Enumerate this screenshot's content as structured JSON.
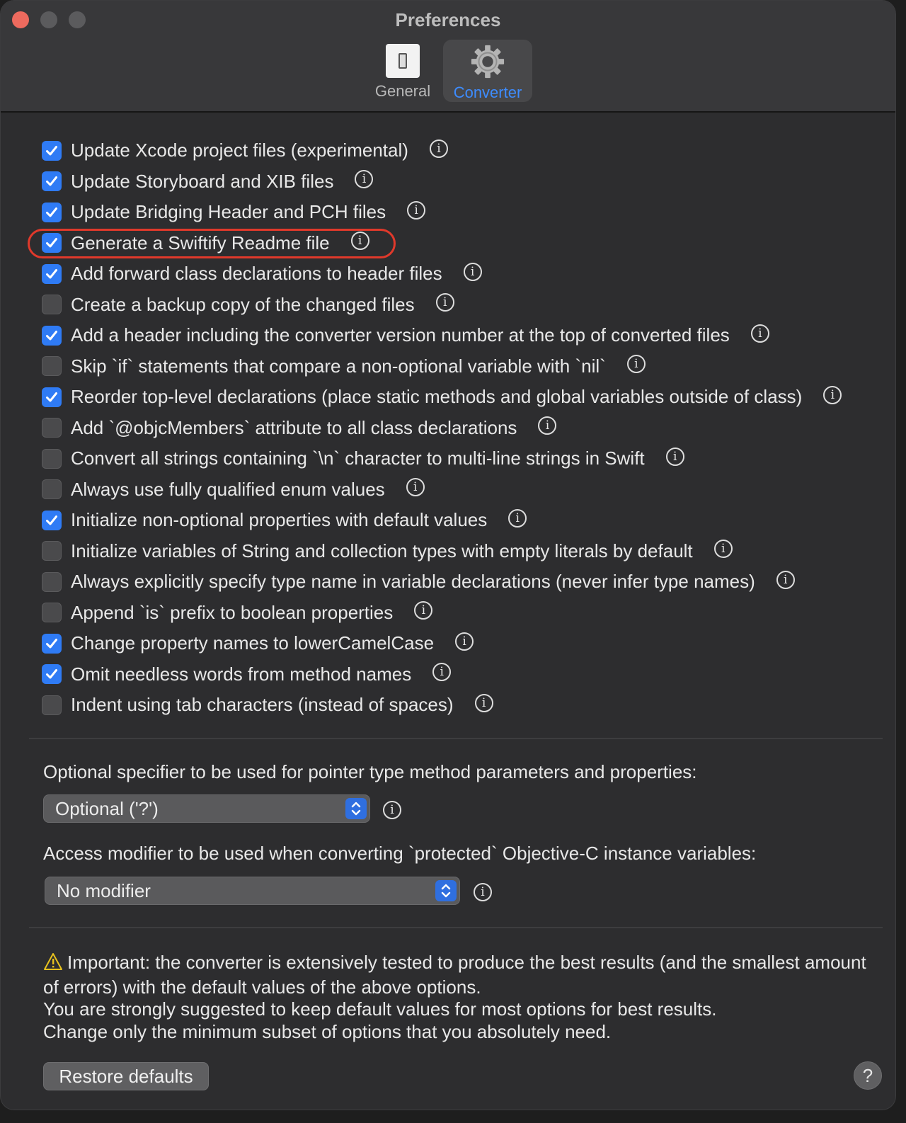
{
  "window": {
    "title": "Preferences"
  },
  "toolbar": {
    "tabs": [
      {
        "label": "General",
        "icon": "general-switch-icon",
        "selected": false
      },
      {
        "label": "Converter",
        "icon": "gear-icon",
        "selected": true
      }
    ]
  },
  "options": [
    {
      "label": "Update Xcode project files (experimental)",
      "checked": true
    },
    {
      "label": "Update Storyboard and XIB files",
      "checked": true
    },
    {
      "label": "Update Bridging Header and PCH files",
      "checked": true
    },
    {
      "label": "Generate a Swiftify Readme file",
      "checked": true,
      "highlighted": true
    },
    {
      "label": "Add forward class declarations to header files",
      "checked": true
    },
    {
      "label": "Create a backup copy of the changed files",
      "checked": false
    },
    {
      "label": "Add a header including the converter version number at the top of converted files",
      "checked": true
    },
    {
      "label": "Skip `if` statements that compare a non-optional variable with `nil`",
      "checked": false
    },
    {
      "label": "Reorder top-level declarations (place static methods and global variables outside of class)",
      "checked": true
    },
    {
      "label": "Add `@objcMembers` attribute to all class declarations",
      "checked": false
    },
    {
      "label": "Convert all strings containing `\\n` character to multi-line strings in Swift",
      "checked": false
    },
    {
      "label": "Always use fully qualified enum values",
      "checked": false
    },
    {
      "label": "Initialize non-optional properties with default values",
      "checked": true
    },
    {
      "label": "Initialize variables of String and collection types with empty literals by default",
      "checked": false
    },
    {
      "label": "Always explicitly specify type name in variable declarations (never infer type names)",
      "checked": false
    },
    {
      "label": "Append `is` prefix to boolean properties",
      "checked": false
    },
    {
      "label": "Change property names to lowerCamelCase",
      "checked": true
    },
    {
      "label": "Omit needless words from method names",
      "checked": true
    },
    {
      "label": "Indent using tab characters (instead of spaces)",
      "checked": false
    }
  ],
  "optional_specifier": {
    "label": "Optional specifier to be used for pointer type method parameters and properties:",
    "value": "Optional ('?')"
  },
  "access_modifier": {
    "label": "Access modifier to be used when converting `protected` Objective-C instance variables:",
    "value": "No modifier"
  },
  "note": {
    "line1": "Important: the converter is extensively tested to produce the best results (and the smallest amount of errors) with the default values of the above options.",
    "line2": "You are strongly suggested to keep default values for most options for best results.",
    "line3": "Change only the minimum subset of options that you absolutely need."
  },
  "buttons": {
    "restore": "Restore defaults",
    "help": "?"
  },
  "colors": {
    "accent": "#2f7bf5",
    "selected_tab_text": "#3d8cff",
    "highlight_ring": "#e0392b",
    "close_button": "#ed6a5e"
  }
}
